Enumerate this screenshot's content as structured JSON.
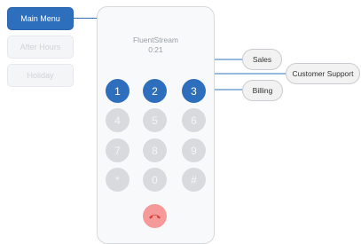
{
  "menus": [
    {
      "label": "Main Menu",
      "active": true
    },
    {
      "label": "After Hours",
      "active": false
    },
    {
      "label": "Holiday",
      "active": false
    }
  ],
  "caller": {
    "name": "FluentStream",
    "duration": "0:21"
  },
  "keypad": [
    {
      "key": "1",
      "active": true
    },
    {
      "key": "2",
      "active": true
    },
    {
      "key": "3",
      "active": true
    },
    {
      "key": "4",
      "active": false
    },
    {
      "key": "5",
      "active": false
    },
    {
      "key": "6",
      "active": false
    },
    {
      "key": "7",
      "active": false
    },
    {
      "key": "8",
      "active": false
    },
    {
      "key": "9",
      "active": false
    },
    {
      "key": "*",
      "active": false
    },
    {
      "key": "0",
      "active": false
    },
    {
      "key": "#",
      "active": false
    }
  ],
  "routes": [
    {
      "key": "1",
      "label": "Sales"
    },
    {
      "key": "2",
      "label": "Customer Support"
    },
    {
      "key": "3",
      "label": "Billing"
    }
  ],
  "colors": {
    "accent": "#2d6fbd",
    "inactive_key": "#d8dadd",
    "hangup": "#f59a98"
  },
  "icons": {
    "hangup": "phone-hangup-icon"
  }
}
